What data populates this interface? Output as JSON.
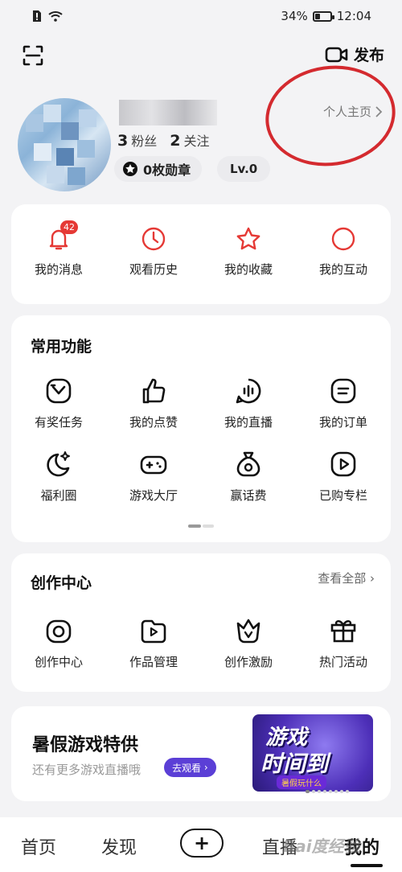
{
  "status_bar": {
    "battery": "34%",
    "time": "12:04",
    "battery_level": 0.34
  },
  "top_bar": {
    "publish_label": "发布"
  },
  "profile": {
    "fans_count": "3",
    "fans_label": "粉丝",
    "follow_count": "2",
    "follow_label": "关注",
    "badge_label": "0枚勋章",
    "level_label": "Lv.0",
    "home_link": "个人主页"
  },
  "quick": [
    {
      "label": "我的消息",
      "icon": "bell-icon",
      "badge": "42"
    },
    {
      "label": "观看历史",
      "icon": "clock-icon"
    },
    {
      "label": "我的收藏",
      "icon": "star-icon"
    },
    {
      "label": "我的互动",
      "icon": "circle-icon"
    }
  ],
  "common": {
    "title": "常用功能",
    "items": [
      {
        "label": "有奖任务",
        "icon": "task-icon"
      },
      {
        "label": "我的点赞",
        "icon": "thumbs-up-icon"
      },
      {
        "label": "我的直播",
        "icon": "live-icon"
      },
      {
        "label": "我的订单",
        "icon": "order-icon"
      },
      {
        "label": "福利圈",
        "icon": "moon-star-icon"
      },
      {
        "label": "游戏大厅",
        "icon": "gamepad-icon"
      },
      {
        "label": "赢话费",
        "icon": "money-bag-icon"
      },
      {
        "label": "已购专栏",
        "icon": "play-column-icon"
      }
    ]
  },
  "creation": {
    "title": "创作中心",
    "see_all": "查看全部",
    "items": [
      {
        "label": "创作中心",
        "icon": "camera-icon"
      },
      {
        "label": "作品管理",
        "icon": "works-icon"
      },
      {
        "label": "创作激励",
        "icon": "crown-icon"
      },
      {
        "label": "热门活动",
        "icon": "gift-icon"
      }
    ]
  },
  "promo": {
    "title": "暑假游戏特供",
    "subtitle": "还有更多游戏直播哦",
    "button": "去观看",
    "art_line1": "游戏",
    "art_line2": "时间到",
    "art_tag": "暑假玩什么"
  },
  "bottom_nav": {
    "home": "首页",
    "discover": "发现",
    "add": "+",
    "live": "直播",
    "mine": "我的"
  },
  "watermark": "Bai度经验",
  "colors": {
    "accent_red": "#e53935",
    "annotation_red": "#d42a2f",
    "promo_purple": "#5b3fd6"
  }
}
